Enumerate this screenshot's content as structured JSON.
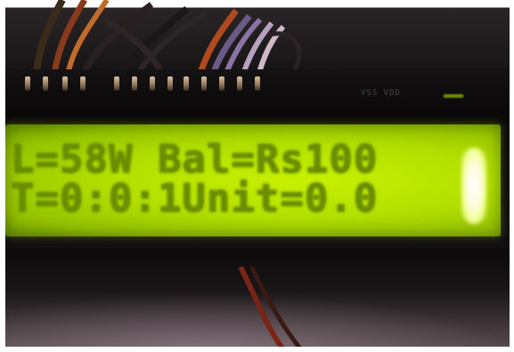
{
  "lcd": {
    "line1": "L=58W Bal=Rs100",
    "line2": "T=0:0:1Unit=0.0"
  },
  "silk_label": "VSS VDD",
  "colors": {
    "backlight": "#b4e000",
    "pixel": "#6b8e00",
    "board": "#0b090a"
  }
}
